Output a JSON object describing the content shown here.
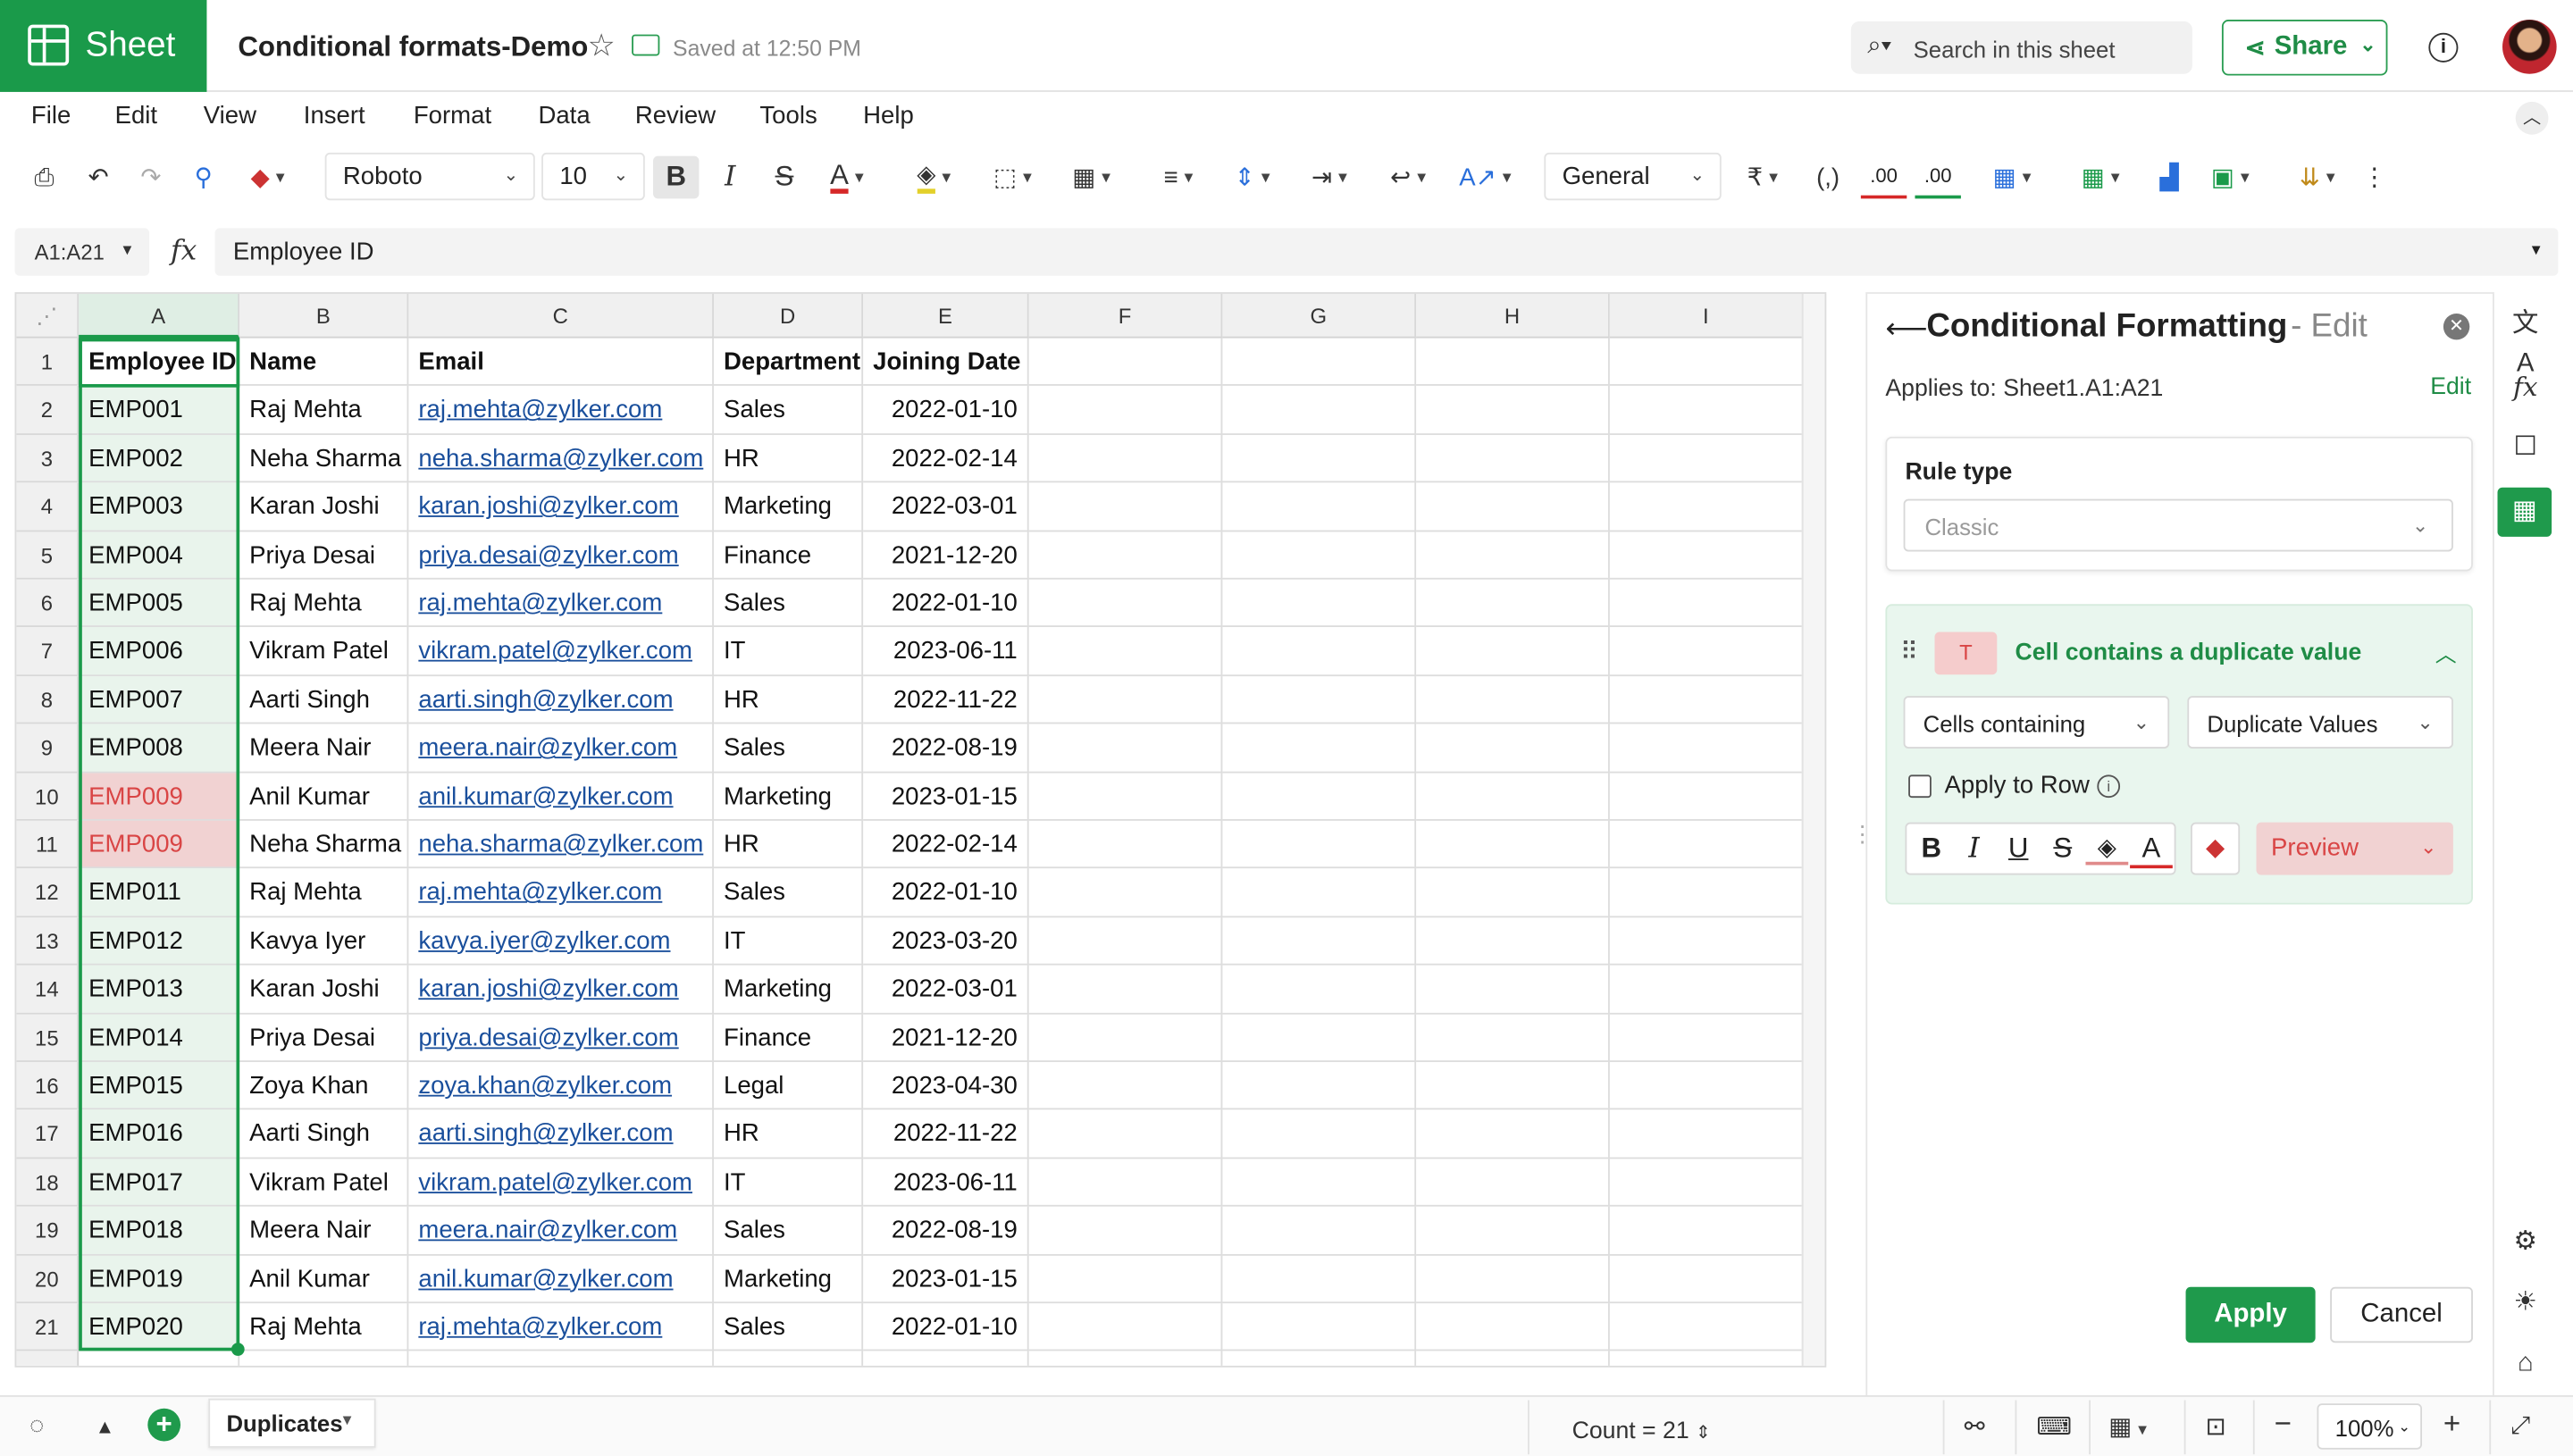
{
  "app": {
    "name": "Sheet",
    "doc_title": "Conditional formats-Demo",
    "save_status": "Saved at 12:50 PM"
  },
  "header": {
    "search_placeholder": "Search in this sheet",
    "share_label": "Share"
  },
  "menu": [
    "File",
    "Edit",
    "View",
    "Insert",
    "Format",
    "Data",
    "Review",
    "Tools",
    "Help"
  ],
  "toolbar": {
    "font": "Roboto",
    "font_size": "10",
    "number_format": "General",
    "currency_symbol": "₹",
    "decimal_dec": ".00",
    "decimal_inc": ".00"
  },
  "formula_bar": {
    "name_box": "A1:A21",
    "fx": "fx",
    "value": "Employee ID"
  },
  "grid": {
    "columns": [
      "A",
      "B",
      "C",
      "D",
      "E",
      "F",
      "G",
      "H",
      "I"
    ],
    "rows": [
      [
        "Employee ID",
        "Name",
        "Email",
        "Department",
        "Joining Date"
      ],
      [
        "EMP001",
        "Raj Mehta",
        "raj.mehta@zylker.com",
        "Sales",
        "2022-01-10"
      ],
      [
        "EMP002",
        "Neha Sharma",
        "neha.sharma@zylker.com",
        "HR",
        "2022-02-14"
      ],
      [
        "EMP003",
        "Karan Joshi",
        "karan.joshi@zylker.com",
        "Marketing",
        "2022-03-01"
      ],
      [
        "EMP004",
        "Priya Desai",
        "priya.desai@zylker.com",
        "Finance",
        "2021-12-20"
      ],
      [
        "EMP005",
        "Raj Mehta",
        "raj.mehta@zylker.com",
        "Sales",
        "2022-01-10"
      ],
      [
        "EMP006",
        "Vikram Patel",
        "vikram.patel@zylker.com",
        "IT",
        "2023-06-11"
      ],
      [
        "EMP007",
        "Aarti Singh",
        "aarti.singh@zylker.com",
        "HR",
        "2022-11-22"
      ],
      [
        "EMP008",
        "Meera Nair",
        "meera.nair@zylker.com",
        "Sales",
        "2022-08-19"
      ],
      [
        "EMP009",
        "Anil Kumar",
        "anil.kumar@zylker.com",
        "Marketing",
        "2023-01-15"
      ],
      [
        "EMP009",
        "Neha Sharma",
        "neha.sharma@zylker.com",
        "HR",
        "2022-02-14"
      ],
      [
        "EMP011",
        "Raj Mehta",
        "raj.mehta@zylker.com",
        "Sales",
        "2022-01-10"
      ],
      [
        "EMP012",
        "Kavya Iyer",
        "kavya.iyer@zylker.com",
        "IT",
        "2023-03-20"
      ],
      [
        "EMP013",
        "Karan Joshi",
        "karan.joshi@zylker.com",
        "Marketing",
        "2022-03-01"
      ],
      [
        "EMP014",
        "Priya Desai",
        "priya.desai@zylker.com",
        "Finance",
        "2021-12-20"
      ],
      [
        "EMP015",
        "Zoya Khan",
        "zoya.khan@zylker.com",
        "Legal",
        "2023-04-30"
      ],
      [
        "EMP016",
        "Aarti Singh",
        "aarti.singh@zylker.com",
        "HR",
        "2022-11-22"
      ],
      [
        "EMP017",
        "Vikram Patel",
        "vikram.patel@zylker.com",
        "IT",
        "2023-06-11"
      ],
      [
        "EMP018",
        "Meera Nair",
        "meera.nair@zylker.com",
        "Sales",
        "2022-08-19"
      ],
      [
        "EMP019",
        "Anil Kumar",
        "anil.kumar@zylker.com",
        "Marketing",
        "2023-01-15"
      ],
      [
        "EMP020",
        "Raj Mehta",
        "raj.mehta@zylker.com",
        "Sales",
        "2022-01-10"
      ]
    ],
    "duplicate_rows": [
      10,
      11
    ],
    "duplicate_color": "#f1d2d2",
    "selection_color": "#1a9a4a"
  },
  "panel": {
    "title": "Conditional Formatting",
    "title_suffix": "- Edit",
    "applies_label": "Applies to:",
    "applies_range": "Sheet1.A1:A21",
    "applies_edit": "Edit",
    "rule_type_label": "Rule type",
    "rule_type_value": "Classic",
    "condition_badge": "T",
    "condition_title": "Cell contains a duplicate value",
    "cells_containing": "Cells containing",
    "duplicate_values": "Duplicate Values",
    "apply_to_row": "Apply to Row",
    "preview": "Preview",
    "apply_button": "Apply",
    "cancel_button": "Cancel"
  },
  "status": {
    "sheet_tab": "Duplicates",
    "count": "Count = 21",
    "zoom": "100%"
  }
}
